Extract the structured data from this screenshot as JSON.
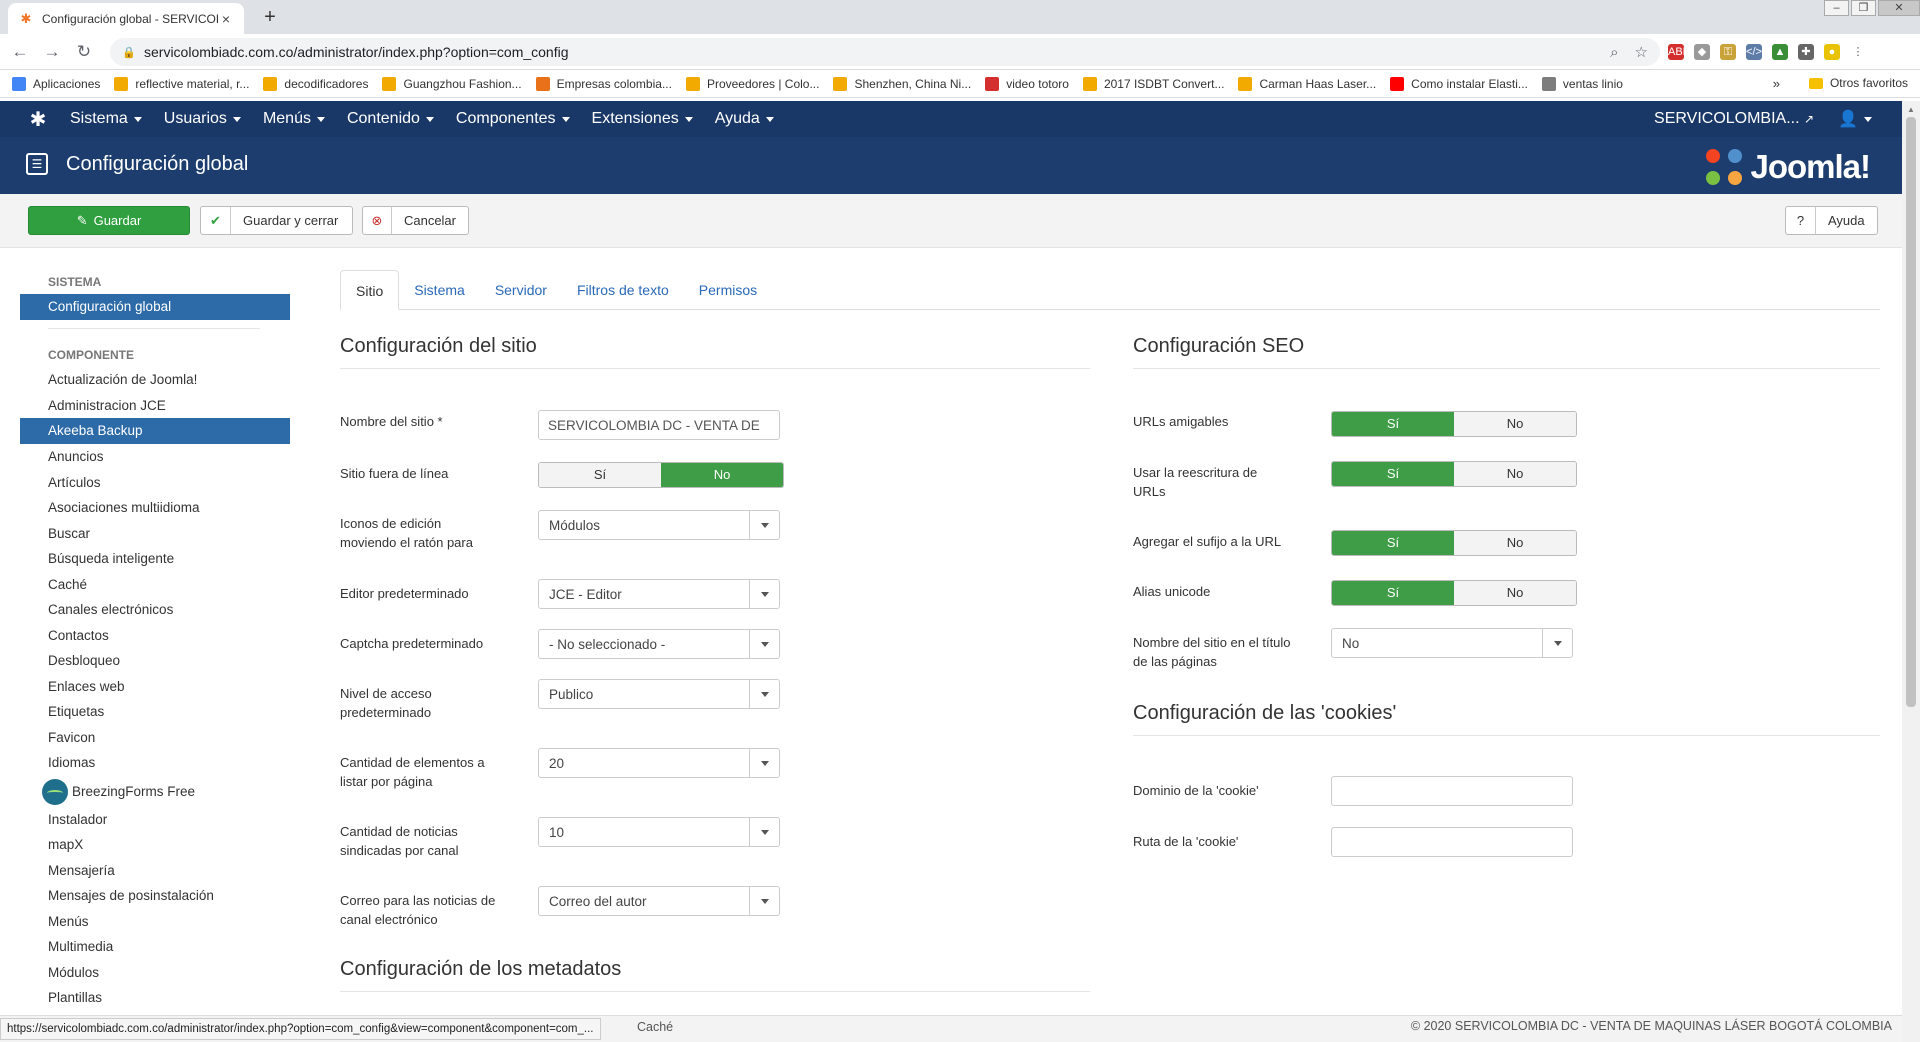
{
  "browser": {
    "tab_title": "Configuración global - SERVICOL",
    "tab_close": "×",
    "new_tab": "+",
    "url": "servicolombiadc.com.co/administrator/index.php?option=com_config",
    "bookmarks": [
      {
        "label": "Aplicaciones",
        "color": "#4285f4"
      },
      {
        "label": "reflective material, r...",
        "color": "#f2a900"
      },
      {
        "label": "decodificadores",
        "color": "#f2a900"
      },
      {
        "label": "Guangzhou Fashion...",
        "color": "#f2a900"
      },
      {
        "label": "Empresas colombia...",
        "color": "#e8711a"
      },
      {
        "label": "Proveedores | Colo...",
        "color": "#f2a900"
      },
      {
        "label": "Shenzhen, China Ni...",
        "color": "#f2a900"
      },
      {
        "label": "video totoro",
        "color": "#d32f2f"
      },
      {
        "label": "2017 ISDBT Convert...",
        "color": "#f2a900"
      },
      {
        "label": "Carman Haas Laser...",
        "color": "#f2a900"
      },
      {
        "label": "Como instalar Elasti...",
        "color": "#ff0000"
      },
      {
        "label": "ventas linio",
        "color": "#7d7d7d"
      }
    ],
    "bookmarks_more": "»",
    "other_bookmarks": "Otros favoritos",
    "status_url": "https://servicolombiadc.com.co/administrator/index.php?option=com_config&view=component&component=com_..."
  },
  "nav": {
    "menus": [
      "Sistema",
      "Usuarios",
      "Menús",
      "Contenido",
      "Componentes",
      "Extensiones",
      "Ayuda"
    ],
    "site_link": "SERVICOLOMBIA...",
    "user_icon": "user-icon"
  },
  "header": {
    "title": "Configuración global",
    "brand": "Joomla!"
  },
  "toolbar": {
    "save": "Guardar",
    "save_close": "Guardar y cerrar",
    "cancel": "Cancelar",
    "help": "Ayuda"
  },
  "sidebar": {
    "system_heading": "Sistema",
    "system_item": "Configuración global",
    "component_heading": "Componente",
    "items": [
      "Actualización de Joomla!",
      "Administracion JCE",
      "Akeeba Backup",
      "Anuncios",
      "Artículos",
      "Asociaciones multiidioma",
      "Buscar",
      "Búsqueda inteligente",
      "Caché",
      "Canales electrónicos",
      "Contactos",
      "Desbloqueo",
      "Enlaces web",
      "Etiquetas",
      "Favicon",
      "Idiomas",
      "BreezingForms Free",
      "Instalador",
      "mapX",
      "Mensajería",
      "Mensajes de posinstalación",
      "Menús",
      "Multimedia",
      "Módulos",
      "Plantillas"
    ]
  },
  "tabs": [
    "Sitio",
    "Sistema",
    "Servidor",
    "Filtros de texto",
    "Permisos"
  ],
  "site": {
    "title": "Configuración del sitio",
    "site_name_label": "Nombre del sitio *",
    "site_name_value": "SERVICOLOMBIA DC - VENTA DE",
    "offline_label": "Sitio fuera de línea",
    "offline_yes": "Sí",
    "offline_no": "No",
    "edit_icons_label_1": "Iconos de edición",
    "edit_icons_label_2": "moviendo el ratón para",
    "edit_icons_value": "Módulos",
    "editor_label": "Editor predeterminado",
    "editor_value": "JCE - Editor",
    "captcha_label": "Captcha predeterminado",
    "captcha_value": "- No seleccionado -",
    "access_label_1": "Nivel de acceso",
    "access_label_2": "predeterminado",
    "access_value": "Publico",
    "list_label_1": "Cantidad de elementos a",
    "list_label_2": "listar por página",
    "list_value": "20",
    "feed_label_1": "Cantidad de noticias",
    "feed_label_2": "sindicadas por canal",
    "feed_value": "10",
    "feed_email_label_1": "Correo para las noticias de",
    "feed_email_label_2": "canal electrónico",
    "feed_email_value": "Correo del autor",
    "meta_title": "Configuración de los metadatos"
  },
  "seo": {
    "title": "Configuración SEO",
    "sef_label": "URLs amigables",
    "rewrite_label_1": "Usar la reescritura de",
    "rewrite_label_2": "URLs",
    "suffix_label": "Agregar el sufijo a la URL",
    "unicode_label": "Alias unicode",
    "yes": "Sí",
    "no": "No",
    "sitename_label_1": "Nombre del sitio en el título",
    "sitename_label_2": "de las páginas",
    "sitename_value": "No"
  },
  "cookies": {
    "title": "Configuración de las 'cookies'",
    "domain_label": "Dominio de la 'cookie'",
    "domain_value": "",
    "path_label": "Ruta de la 'cookie'",
    "path_value": ""
  },
  "footer": {
    "partial_item": "Caché",
    "copyright": "© 2020 SERVICOLOMBIA DC - VENTA DE MAQUINAS LÁSER BOGOTÁ COLOMBIA"
  },
  "colors": {
    "nav_bg": "#1a3867",
    "header_bg": "#1c3d6e",
    "save_green": "#2f9f3f",
    "toggle_on": "#3e9d46",
    "sidebar_active": "#2d6aa8",
    "link_blue": "#2a69b8"
  }
}
